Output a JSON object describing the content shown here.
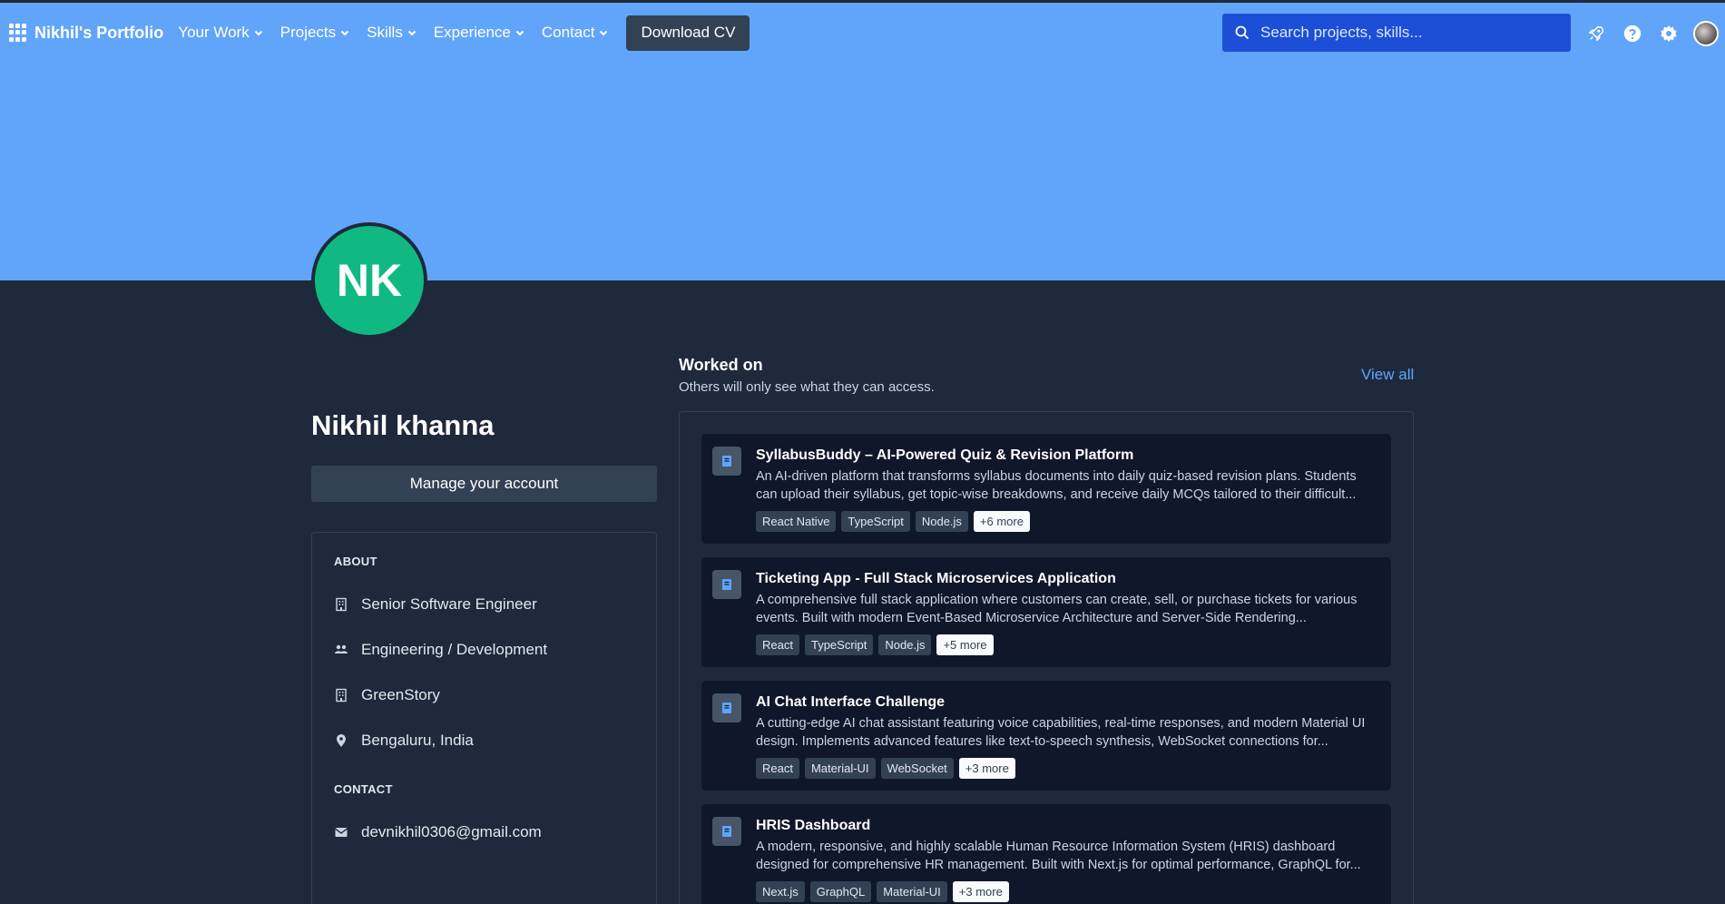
{
  "header": {
    "brand": "Nikhil's Portfolio",
    "nav": [
      {
        "label": "Your Work"
      },
      {
        "label": "Projects"
      },
      {
        "label": "Skills"
      },
      {
        "label": "Experience"
      },
      {
        "label": "Contact"
      }
    ],
    "cv_button": "Download CV",
    "search_placeholder": "Search projects, skills...",
    "icons": [
      "rocket-icon",
      "help-icon",
      "gear-icon",
      "avatar"
    ]
  },
  "profile": {
    "initials": "NK",
    "name": "Nikhil khanna",
    "manage_button": "Manage your account",
    "about_label": "ABOUT",
    "about": [
      {
        "icon": "building-icon",
        "text": "Senior Software Engineer"
      },
      {
        "icon": "people-icon",
        "text": "Engineering / Development"
      },
      {
        "icon": "building-icon",
        "text": "GreenStory"
      },
      {
        "icon": "location-pin-icon",
        "text": "Bengaluru, India"
      }
    ],
    "contact_label": "CONTACT",
    "email": "devnikhil0306@gmail.com"
  },
  "worked_on": {
    "title": "Worked on",
    "subtitle": "Others will only see what they can access.",
    "view_all": "View all",
    "projects": [
      {
        "title": "SyllabusBuddy – AI-Powered Quiz & Revision Platform",
        "description": "An AI-driven platform that transforms syllabus documents into daily quiz-based revision plans. Students can upload their syllabus, get topic-wise breakdowns, and receive daily MCQs tailored to their difficult...",
        "tags": [
          "React Native",
          "TypeScript",
          "Node.js"
        ],
        "more": "+6 more"
      },
      {
        "title": "Ticketing App - Full Stack Microservices Application",
        "description": "A comprehensive full stack application where customers can create, sell, or purchase tickets for various events. Built with modern Event-Based Microservice Architecture and Server-Side Rendering...",
        "tags": [
          "React",
          "TypeScript",
          "Node.js"
        ],
        "more": "+5 more"
      },
      {
        "title": "AI Chat Interface Challenge",
        "description": "A cutting-edge AI chat assistant featuring voice capabilities, real-time responses, and modern Material UI design. Implements advanced features like text-to-speech synthesis, WebSocket connections for...",
        "tags": [
          "React",
          "Material-UI",
          "WebSocket"
        ],
        "more": "+3 more"
      },
      {
        "title": "HRIS Dashboard",
        "description": "A modern, responsive, and highly scalable Human Resource Information System (HRIS) dashboard designed for comprehensive HR management. Built with Next.js for optimal performance, GraphQL for...",
        "tags": [
          "Next.js",
          "GraphQL",
          "Material-UI"
        ],
        "more": "+3 more"
      }
    ]
  },
  "colors": {
    "hero": "#60a5fa",
    "page_bg": "#1e293b",
    "avatar": "#10b981",
    "link": "#60a5fa",
    "search_bg": "#1d4ed8"
  }
}
